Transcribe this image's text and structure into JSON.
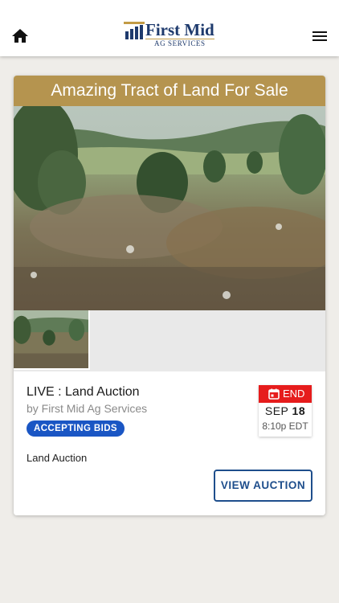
{
  "header": {
    "logo_title": "First Mid",
    "logo_subtitle": "AG SERVICES",
    "brand_navy": "#1e3a6d",
    "brand_gold": "#c29b45",
    "home_icon": "home-icon",
    "menu_icon": "hamburger-menu-icon"
  },
  "listing": {
    "banner_title": "Amazing Tract of Land For Sale",
    "banner_color": "#b5944f",
    "title": "LIVE : Land Auction",
    "byline": "by First Mid Ag Services",
    "status": "ACCEPTING BIDS",
    "status_color": "#1a56c4",
    "description": "Land Auction",
    "end": {
      "label": "END",
      "month": "SEP",
      "day": "18",
      "time": "8:10p EDT",
      "color": "#e61c1c"
    },
    "view_button": "VIEW AUCTION"
  }
}
